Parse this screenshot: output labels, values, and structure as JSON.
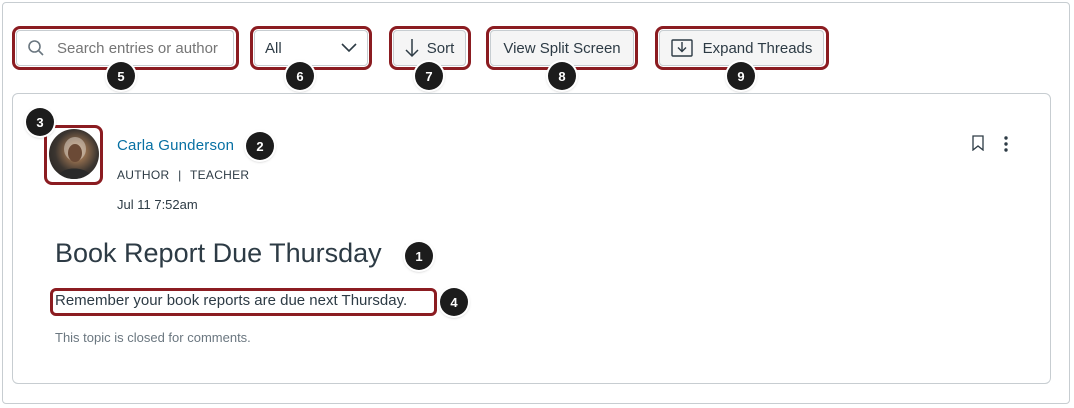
{
  "toolbar": {
    "search_placeholder": "Search entries or author",
    "filter_value": "All",
    "sort_label": "Sort",
    "split_label": "View Split Screen",
    "expand_label": "Expand Threads"
  },
  "post": {
    "author_name": "Carla Gunderson",
    "role_author": "AUTHOR",
    "role_sep": "|",
    "role_teacher": "TEACHER",
    "timestamp": "Jul 11 7:52am",
    "title": "Book Report Due Thursday",
    "body": "Remember your book reports are due next Thursday.",
    "closed_note": "This topic is closed for comments."
  },
  "badges": {
    "b1": "1",
    "b2": "2",
    "b3": "3",
    "b4": "4",
    "b5": "5",
    "b6": "6",
    "b7": "7",
    "b8": "8",
    "b9": "9"
  },
  "colors": {
    "highlight": "#8b1c21",
    "link": "#0770a3",
    "text": "#2d3b45"
  },
  "icons": [
    "search-icon",
    "chevron-down-icon",
    "arrow-down-icon",
    "expand-icon",
    "bookmark-icon",
    "kebab-menu-icon"
  ]
}
